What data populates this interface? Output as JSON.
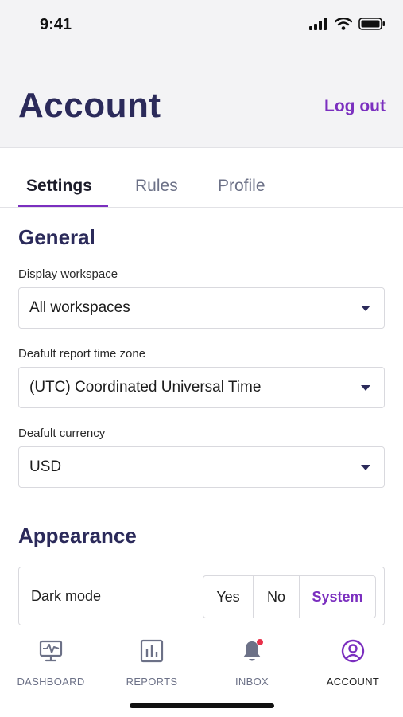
{
  "status_bar": {
    "time": "9:41"
  },
  "header": {
    "title": "Account",
    "logout_label": "Log out"
  },
  "tabs": [
    {
      "label": "Settings",
      "active": true
    },
    {
      "label": "Rules",
      "active": false
    },
    {
      "label": "Profile",
      "active": false
    }
  ],
  "general": {
    "title": "General",
    "fields": [
      {
        "label": "Display workspace",
        "value": "All workspaces"
      },
      {
        "label": "Deafult report time zone",
        "value": "(UTC) Coordinated Universal Time"
      },
      {
        "label": "Deafult currency",
        "value": "USD"
      }
    ]
  },
  "appearance": {
    "title": "Appearance",
    "dark_mode_label": "Dark mode",
    "options": [
      "Yes",
      "No",
      "System"
    ],
    "selected": "System"
  },
  "bottom_nav": [
    {
      "label": "DASHBOARD",
      "icon": "monitor-icon"
    },
    {
      "label": "REPORTS",
      "icon": "bar-chart-icon"
    },
    {
      "label": "INBOX",
      "icon": "bell-icon",
      "has_notification": true
    },
    {
      "label": "ACCOUNT",
      "icon": "user-circle-icon",
      "active": true
    }
  ],
  "colors": {
    "accent": "#7b2fbf",
    "heading": "#2b2a5a",
    "muted": "#6c7187",
    "notification_dot": "#e8304a",
    "header_bg": "#f3f3f5"
  }
}
